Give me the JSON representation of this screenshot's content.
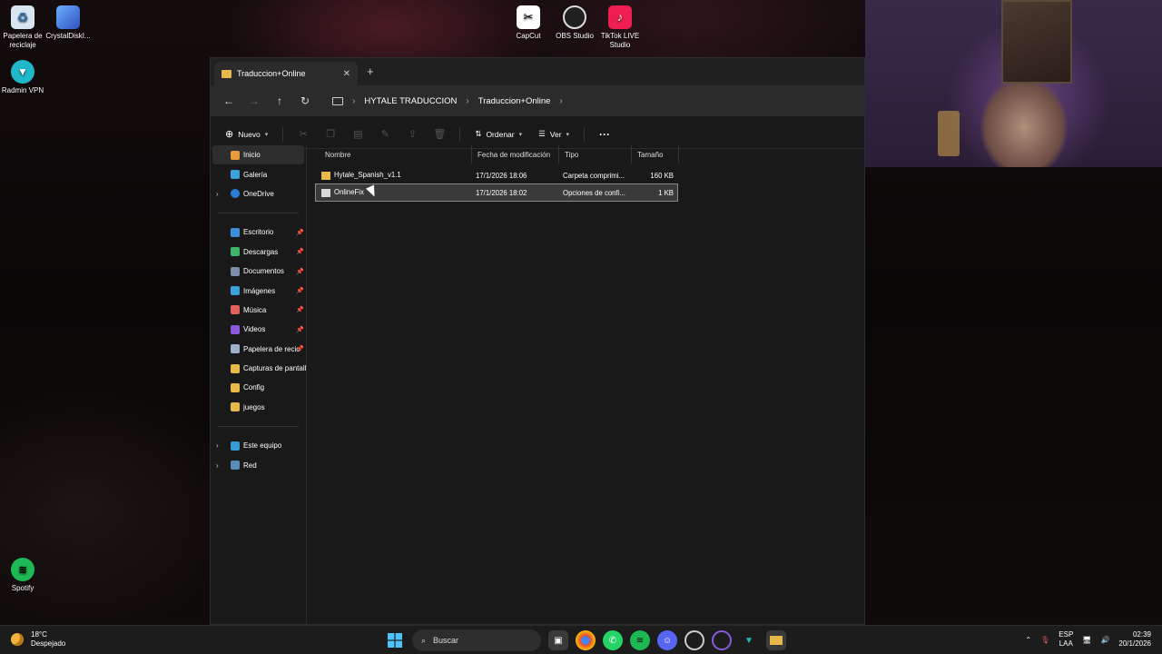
{
  "desktop": {
    "icons": [
      {
        "label": "Papelera de reciclaje"
      },
      {
        "label": "CrystalDiskI..."
      },
      {
        "label": "Radmin VPN"
      },
      {
        "label": "CapCut"
      },
      {
        "label": "OBS Studio"
      },
      {
        "label": "TikTok LIVE Studio"
      },
      {
        "label": "Spotify"
      }
    ]
  },
  "window": {
    "tab_title": "Traduccion+Online",
    "close_glyph": "✕",
    "new_tab_glyph": "+",
    "breadcrumb": [
      "HYTALE TRADUCCION",
      "Traduccion+Online"
    ],
    "toolbar": {
      "new_label": "Nuevo",
      "sort_label": "Ordenar",
      "view_label": "Ver",
      "more_glyph": "···"
    },
    "nav": {
      "home": "Inicio",
      "gallery": "Galería",
      "onedrive": "OneDrive",
      "quick": [
        {
          "label": "Escritorio",
          "color": "#3a8fd8"
        },
        {
          "label": "Descargas",
          "color": "#3fb36b"
        },
        {
          "label": "Documentos",
          "color": "#7d8fa8"
        },
        {
          "label": "Imágenes",
          "color": "#3aa2d8"
        },
        {
          "label": "Música",
          "color": "#e0605a"
        },
        {
          "label": "Videos",
          "color": "#8a5ad8"
        },
        {
          "label": "Papelera de recic",
          "color": "#9ab0c8"
        },
        {
          "label": "Capturas de pantall",
          "color": "#e8b84a"
        },
        {
          "label": "Config",
          "color": "#e8b84a"
        },
        {
          "label": "juegos",
          "color": "#e8b84a"
        }
      ],
      "this_pc": "Este equipo",
      "network": "Red"
    },
    "columns": {
      "name": "Nombre",
      "modified": "Fecha de modificación",
      "type": "Tipo",
      "size": "Tamaño"
    },
    "files": [
      {
        "name": "Hytale_Spanish_v1.1",
        "modified": "17/1/2026 18:06",
        "type": "Carpeta comprimi...",
        "size": "160 KB",
        "icon": "zip-folder-icon"
      },
      {
        "name": "OnlineFix",
        "modified": "17/1/2026 18:02",
        "type": "Opciones de confi...",
        "size": "1 KB",
        "icon": "config-file-icon"
      }
    ]
  },
  "taskbar": {
    "weather_temp": "18°C",
    "weather_desc": "Despejado",
    "search_placeholder": "Buscar",
    "lang_top": "ESP",
    "lang_bottom": "LAA",
    "time": "02:39",
    "date": "20/1/2026"
  }
}
